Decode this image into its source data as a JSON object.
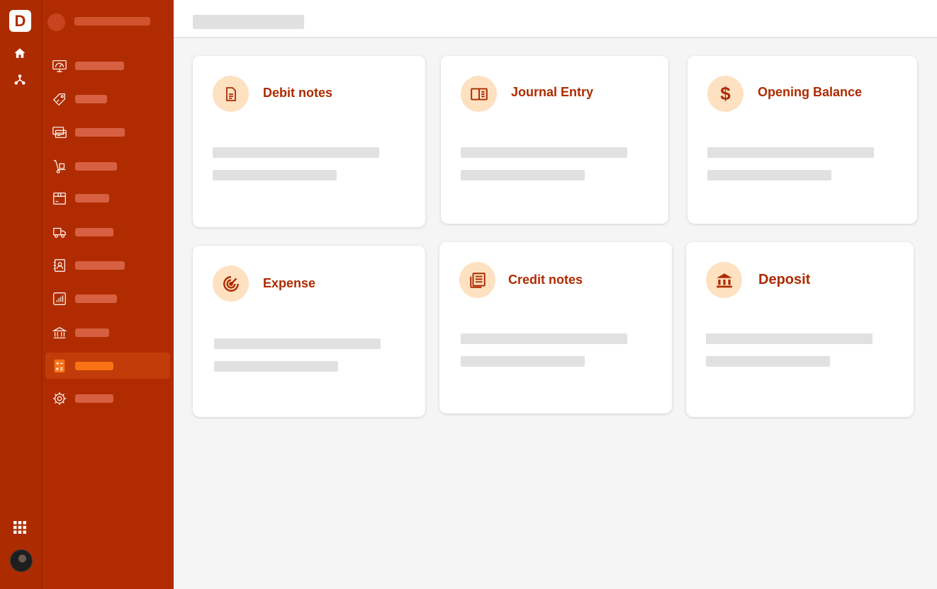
{
  "app": {
    "logo_letter": "D",
    "brand_color": "#ad2b00",
    "accent_color": "#f97316"
  },
  "rail": {
    "icons": [
      "home-icon",
      "hierarchy-icon",
      "apps-grid-icon"
    ],
    "avatar": "user-avatar"
  },
  "sidebar": {
    "items": [
      {
        "icon": "dashboard-monitor-icon",
        "active": false
      },
      {
        "icon": "tag-icon",
        "active": false
      },
      {
        "icon": "cards-icon",
        "active": false
      },
      {
        "icon": "hand-truck-icon",
        "active": false
      },
      {
        "icon": "box-icon",
        "active": false
      },
      {
        "icon": "delivery-truck-icon",
        "active": false
      },
      {
        "icon": "contacts-book-icon",
        "active": false
      },
      {
        "icon": "report-chart-icon",
        "active": false
      },
      {
        "icon": "bank-icon",
        "active": false
      },
      {
        "icon": "calculator-icon",
        "active": true
      },
      {
        "icon": "settings-gear-icon",
        "active": false
      }
    ]
  },
  "cards": [
    {
      "title": "Debit notes",
      "icon": "document-icon"
    },
    {
      "title": "Journal Entry",
      "icon": "open-book-icon"
    },
    {
      "title": "Opening Balance",
      "icon": "dollar-icon"
    },
    {
      "title": "Expense",
      "icon": "target-icon"
    },
    {
      "title": "Credit notes",
      "icon": "newspaper-icon"
    },
    {
      "title": "Deposit",
      "icon": "bank-icon"
    }
  ]
}
